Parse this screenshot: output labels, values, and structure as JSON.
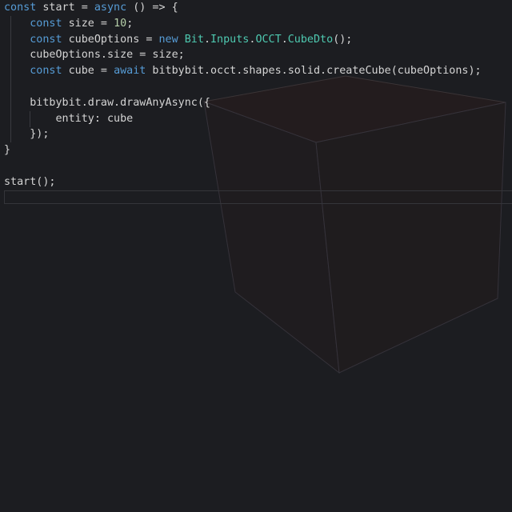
{
  "colors": {
    "background": "#1c1d21",
    "keyword": "#569cd6",
    "number": "#b5cea8",
    "class": "#4ec9b0",
    "text": "#d4d4d4"
  },
  "code": {
    "lines": [
      [
        [
          "kw",
          "const"
        ],
        [
          "t",
          " start = "
        ],
        [
          "kw",
          "async"
        ],
        [
          "t",
          " () => {"
        ]
      ],
      [
        [
          "t",
          "    "
        ],
        [
          "kw",
          "const"
        ],
        [
          "t",
          " size = "
        ],
        [
          "num",
          "10"
        ],
        [
          "t",
          ";"
        ]
      ],
      [
        [
          "t",
          "    "
        ],
        [
          "kw",
          "const"
        ],
        [
          "t",
          " cubeOptions = "
        ],
        [
          "kw",
          "new"
        ],
        [
          "t",
          " "
        ],
        [
          "cls",
          "Bit"
        ],
        [
          "t",
          "."
        ],
        [
          "cls",
          "Inputs"
        ],
        [
          "t",
          "."
        ],
        [
          "cls",
          "OCCT"
        ],
        [
          "t",
          "."
        ],
        [
          "cls",
          "CubeDto"
        ],
        [
          "t",
          "();"
        ]
      ],
      [
        [
          "t",
          "    cubeOptions.size = size;"
        ]
      ],
      [
        [
          "t",
          "    "
        ],
        [
          "kw",
          "const"
        ],
        [
          "t",
          " cube = "
        ],
        [
          "kw",
          "await"
        ],
        [
          "t",
          " bitbybit.occt.shapes.solid.createCube(cubeOptions);"
        ]
      ],
      [
        [
          "t",
          ""
        ]
      ],
      [
        [
          "t",
          "    bitbybit.draw.drawAnyAsync({"
        ]
      ],
      [
        [
          "t",
          "        entity: cube"
        ]
      ],
      [
        [
          "t",
          "    });"
        ]
      ],
      [
        [
          "t",
          "}"
        ]
      ],
      [
        [
          "t",
          ""
        ]
      ],
      [
        [
          "t",
          "start();"
        ]
      ]
    ]
  }
}
